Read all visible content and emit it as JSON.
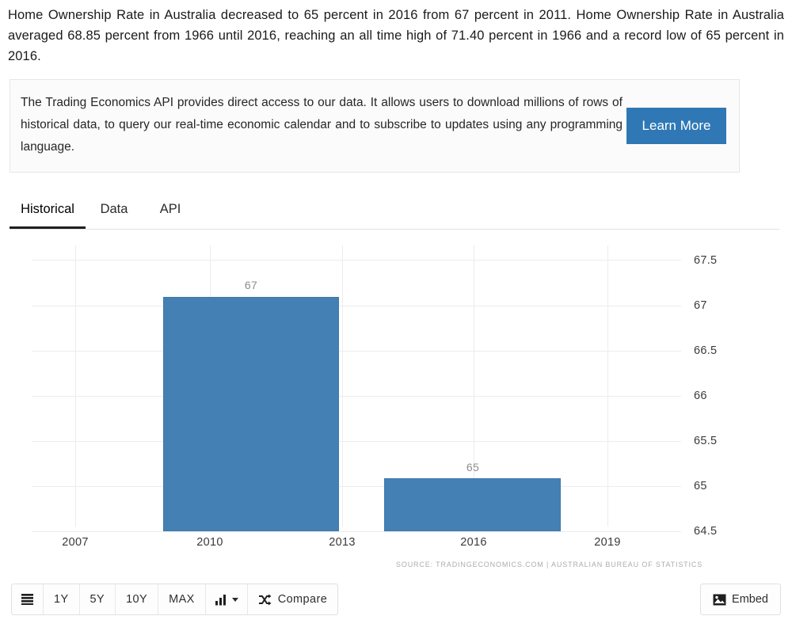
{
  "intro": {
    "paragraph": "Home Ownership Rate in Australia decreased to 65 percent in 2016 from 67 percent in 2011. Home Ownership Rate in Australia averaged 68.85 percent from 1966 until 2016, reaching an all time high of 71.40 percent in 1966 and a record low of 65 percent in 2016."
  },
  "promo": {
    "text": "The Trading Economics API provides direct access to our data. It allows users to download millions of rows of historical data, to query our real-time economic calendar and to subscribe to updates using any programming language.",
    "button_label": "Learn More",
    "button_color": "#2f78b5"
  },
  "tabs": [
    {
      "label": "Historical",
      "active": true
    },
    {
      "label": "Data",
      "active": false
    },
    {
      "label": "API",
      "active": false
    }
  ],
  "chart_data": {
    "type": "bar",
    "title": "",
    "xlabel": "",
    "ylabel": "",
    "categories": [
      "2011",
      "2016"
    ],
    "values": [
      67,
      65
    ],
    "bar_labels": [
      "67",
      "65"
    ],
    "series": [
      {
        "name": "Home Ownership Rate",
        "values": [
          67,
          65
        ]
      }
    ],
    "ylim": [
      64.5,
      67.5
    ],
    "ytick_labels": [
      "67.5",
      "67",
      "66.5",
      "66",
      "65.5",
      "65",
      "64.5"
    ],
    "ytick_values": [
      67.5,
      67,
      66.5,
      66,
      65.5,
      65,
      64.5
    ],
    "xtick_labels": [
      "2007",
      "2010",
      "2013",
      "2016",
      "2019"
    ],
    "xlim": [
      2005.6,
      2020.8
    ],
    "grid": true,
    "legend": "none",
    "bar_color": "#4580b4",
    "source": "SOURCE: TRADINGECONOMICS.COM  |  AUSTRALIAN BUREAU OF STATISTICS"
  },
  "toolbar": {
    "buttons": [
      {
        "label": "",
        "icon": "list-icon"
      },
      {
        "label": "1Y",
        "icon": ""
      },
      {
        "label": "5Y",
        "icon": ""
      },
      {
        "label": "10Y",
        "icon": ""
      },
      {
        "label": "MAX",
        "icon": ""
      },
      {
        "label": "",
        "icon": "bar-chart-icon"
      },
      {
        "label": "Compare",
        "icon": "shuffle-icon"
      }
    ],
    "embed_label": "Embed"
  }
}
